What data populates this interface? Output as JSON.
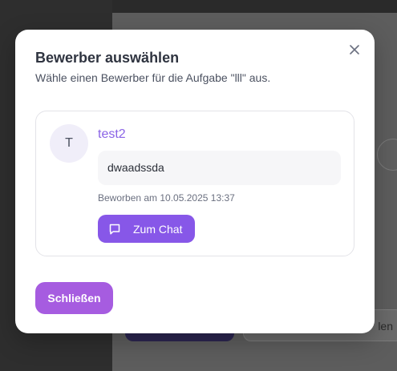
{
  "background": {
    "partial_button_label": "len"
  },
  "dialog": {
    "title": "Bewerber auswählen",
    "subtitle": "Wähle einen Bewerber für die Aufgabe \"lll\" aus.",
    "close_icon": "close-icon"
  },
  "applicants": [
    {
      "initial": "T",
      "name": "test2",
      "message": "dwaadssda",
      "applied_at": "Beworben am 10.05.2025 13:37",
      "chat_label": "Zum Chat",
      "chat_icon": "chat-bubble-icon"
    }
  ],
  "footer": {
    "close_label": "Schließen"
  },
  "colors": {
    "accent": "#8757e8",
    "name": "#8a63e6",
    "close_button": "#a65ce0"
  }
}
